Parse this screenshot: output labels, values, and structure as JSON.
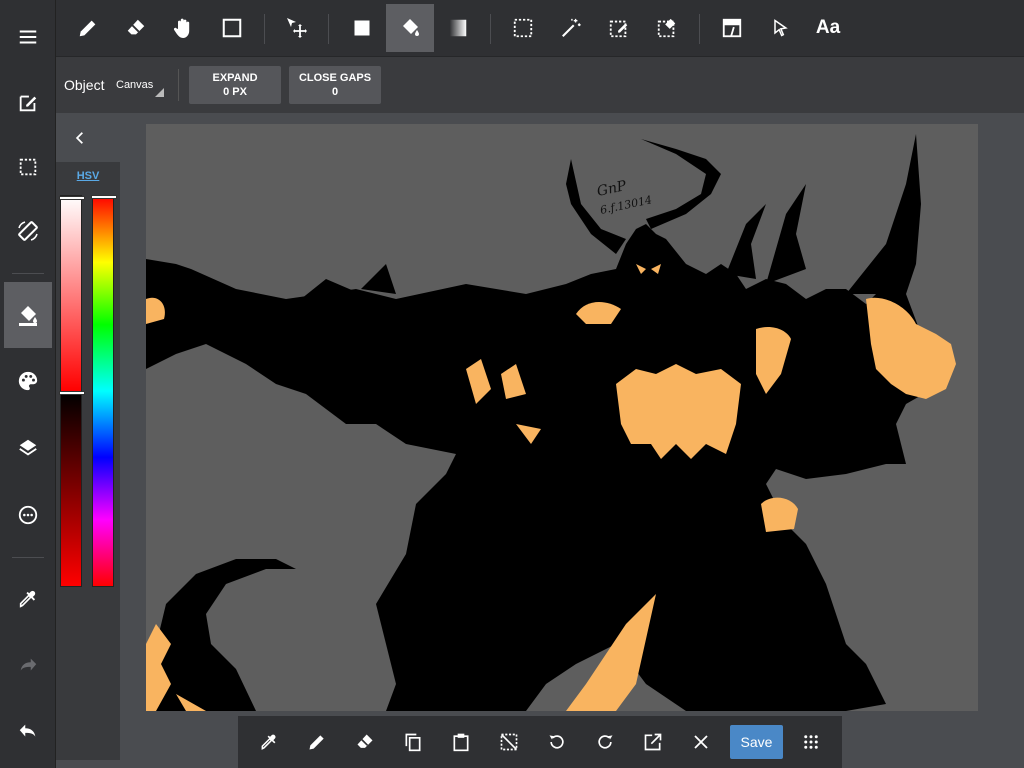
{
  "sidebar": {
    "items": [
      {
        "icon": "menu-icon",
        "label": ""
      },
      {
        "icon": "edit-canvas-icon",
        "label": ""
      },
      {
        "icon": "selection-icon",
        "label": ""
      },
      {
        "icon": "rotate-screen-icon",
        "label": ""
      },
      {
        "icon": "fill-bucket-icon",
        "label": "",
        "active": true
      },
      {
        "icon": "palette-icon",
        "label": ""
      },
      {
        "icon": "layers-icon",
        "label": ""
      },
      {
        "icon": "more-options-icon",
        "label": ""
      },
      {
        "icon": "eyedropper-icon",
        "label": ""
      },
      {
        "icon": "redo-icon",
        "label": "",
        "disabled": true
      },
      {
        "icon": "undo-icon",
        "label": ""
      }
    ]
  },
  "toolbar": {
    "tools": [
      "pencil-icon",
      "eraser-icon",
      "hand-icon",
      "shape-icon",
      "move-icon",
      "fill-color-icon",
      "bucket-icon",
      "gradient-icon",
      "rect-select-icon",
      "magic-wand-icon",
      "lasso-select-icon",
      "select-eraser-icon",
      "frame-icon",
      "pointer-icon",
      "text-icon"
    ],
    "text_tool_label": "Aa",
    "active_tool": "bucket-icon"
  },
  "options": {
    "object_label": "Object",
    "object_value": "Canvas",
    "expand_label": "EXPAND",
    "expand_value": "0 PX",
    "close_gaps_label": "CLOSE GAPS",
    "close_gaps_value": "0"
  },
  "color_panel": {
    "mode_label": "HSV",
    "hue_position": 0.0,
    "sat_value_position": 0.5
  },
  "canvas": {
    "background_color": "#5e5e5e",
    "silhouette_color": "#000000",
    "accent_color": "#f9b460",
    "signature_text": "GnP",
    "signature_date": "6.f.13014"
  },
  "bottom_bar": {
    "tools": [
      "eyedropper-icon",
      "pencil-icon",
      "eraser-icon",
      "copy-icon",
      "paste-icon",
      "deselect-icon",
      "rotate-left-icon",
      "rotate-right-icon",
      "export-icon",
      "close-icon"
    ],
    "save_label": "Save",
    "grid_icon": "grid-icon"
  },
  "colors": {
    "toolbar_bg": "#2f3033",
    "active_bg": "#5d5e62",
    "save_button": "#4a88c7",
    "link_blue": "#5aa9e6"
  }
}
